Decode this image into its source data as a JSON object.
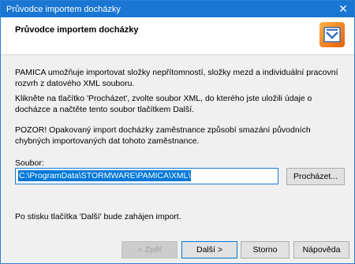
{
  "window": {
    "title": "Průvodce importem docházky"
  },
  "header": {
    "title": "Průvodce importem docházky"
  },
  "content": {
    "paragraph1": "PAMICA umožňuje importovat složky nepřítomností, složky mezd a individuální pracovní rozvrh z datového XML souboru.",
    "paragraph2": "Klikněte na tlačítko 'Procházet', zvolte soubor XML, do kterého jste uložili údaje o docházce a načtěte tento soubor tlačítkem Další.",
    "paragraph3": "POZOR! Opakovaný import docházky zaměstnance způsobí smazání původních chybných importovaných dat tohoto zaměstnance.",
    "file_label": "Soubor:",
    "file_value": "C:\\ProgramData\\STORMWARE\\PAMICA\\XML\\",
    "browse_label": "Procházet...",
    "paragraph4": "Po stisku tlačítka 'Další' bude zahájen import."
  },
  "footer": {
    "back_label": "< Zpět",
    "next_label": "Další >",
    "cancel_label": "Storno",
    "help_label": "Nápověda"
  },
  "colors": {
    "titlebar": "#1976d2",
    "accent": "#0078d7"
  },
  "icons": {
    "close": "close-icon",
    "logo": "pamica-logo-icon"
  }
}
